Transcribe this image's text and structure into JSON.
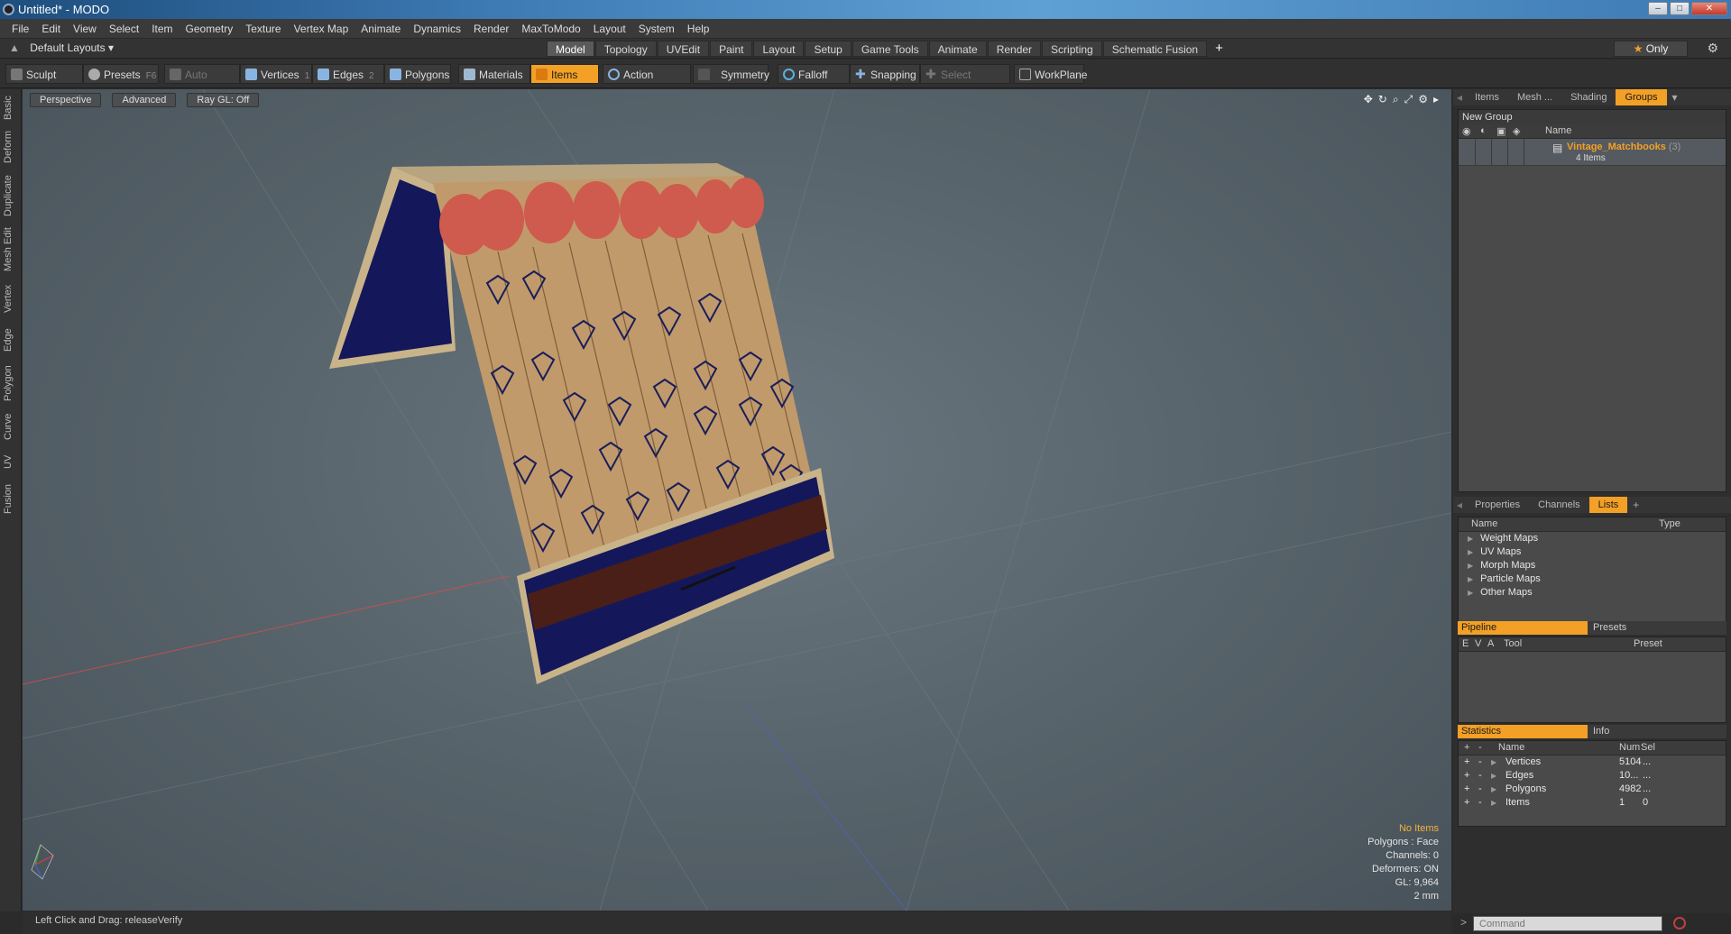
{
  "window": {
    "title": "Untitled* - MODO",
    "controls": [
      "–",
      "□",
      "✕"
    ]
  },
  "menu": [
    "File",
    "Edit",
    "View",
    "Select",
    "Item",
    "Geometry",
    "Texture",
    "Vertex Map",
    "Animate",
    "Dynamics",
    "Render",
    "MaxToModo",
    "Layout",
    "System",
    "Help"
  ],
  "layout": {
    "selector": "Default Layouts",
    "tabs": [
      "Model",
      "Topology",
      "UVEdit",
      "Paint",
      "Layout",
      "Setup",
      "Game Tools",
      "Animate",
      "Render",
      "Scripting",
      "Schematic Fusion"
    ],
    "active_tab": "Model",
    "add": "+",
    "only": "Only"
  },
  "toolbar": {
    "sculpt": "Sculpt",
    "presets": "Presets",
    "presets_key": "F6",
    "auto_select": "Auto Select",
    "vertices": "Vertices",
    "vertices_key": "1",
    "edges": "Edges",
    "edges_key": "2",
    "polygons": "Polygons",
    "materials": "Materials",
    "items": "Items",
    "action_center": "Action Center",
    "symmetry": "Symmetry",
    "falloff": "Falloff",
    "snapping": "Snapping",
    "select_through": "Select Through",
    "workplane": "WorkPlane"
  },
  "left_tabs": [
    "Basic",
    "Deform",
    "Duplicate",
    "Mesh Edit",
    "Vertex",
    "Edge",
    "Polygon",
    "Curve",
    "UV",
    "Fusion"
  ],
  "viewport": {
    "perspective": "Perspective",
    "advanced": "Advanced",
    "raygl": "Ray GL: Off",
    "info": {
      "no_items": "No Items",
      "polygons": "Polygons : Face",
      "channels": "Channels: 0",
      "deformers": "Deformers: ON",
      "gl": "GL: 9,964",
      "scale": "2 mm"
    }
  },
  "status": {
    "text": "Left Click and Drag:   releaseVerify"
  },
  "right_panel": {
    "top_tabs": [
      "Items",
      "Mesh ...",
      "Shading",
      "Groups"
    ],
    "active_top_tab": "Groups",
    "new_group": "New Group",
    "name_col": "Name",
    "group": {
      "name": "Vintage_Matchbooks",
      "count": "(3)",
      "items": "4 Items"
    },
    "mid_tabs": [
      "Properties",
      "Channels",
      "Lists"
    ],
    "active_mid_tab": "Lists",
    "lists_header": {
      "name": "Name",
      "type": "Type"
    },
    "lists": [
      "Weight Maps",
      "UV Maps",
      "Morph Maps",
      "Particle Maps",
      "Other Maps"
    ],
    "pipeline": {
      "tab": "Pipeline",
      "presets": "Presets",
      "cols": [
        "E",
        "V",
        "A",
        "Tool",
        "Preset"
      ]
    },
    "statistics": {
      "tab": "Statistics",
      "info": "Info",
      "cols": {
        "plus": "+",
        "minus": "-",
        "name": "Name",
        "num": "Num",
        "sel": "Sel"
      },
      "rows": [
        {
          "name": "Vertices",
          "num": "5104",
          "sel": "..."
        },
        {
          "name": "Edges",
          "num": "10...",
          "sel": "..."
        },
        {
          "name": "Polygons",
          "num": "4982",
          "sel": "..."
        },
        {
          "name": "Items",
          "num": "1",
          "sel": "0"
        }
      ]
    },
    "command_placeholder": "Command"
  },
  "colors": {
    "accent": "#f3a026",
    "viewport_bg": "#5f6b73",
    "panel": "#2e2e2e"
  }
}
